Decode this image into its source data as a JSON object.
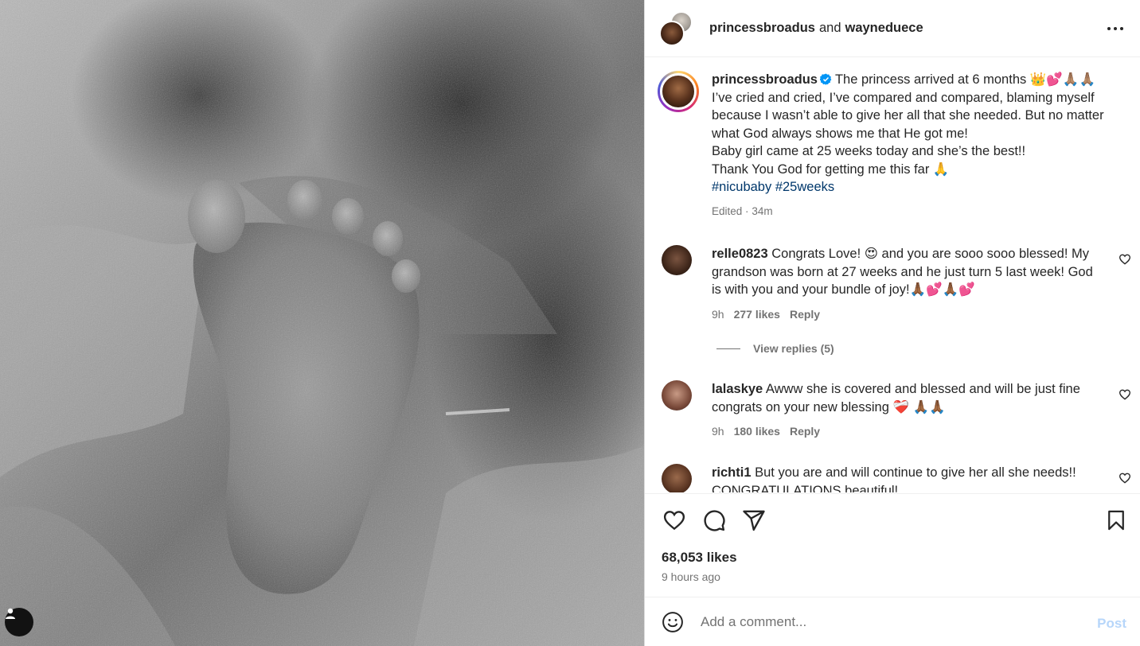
{
  "post": {
    "header": {
      "author": "princessbroadus",
      "joiner": "and",
      "collaborator": "wayneduece"
    },
    "caption": {
      "username": "princessbroadus",
      "lines": [
        "The princess arrived at 6 months 👑💕🙏🏽🙏🏽",
        "I’ve cried and cried, I’ve compared and compared, blaming myself because I wasn’t able to give her all that she needed. But no matter what God always shows me that He got me!",
        "Baby girl came at 25 weeks today and she’s the best!!",
        "Thank You God for getting me this far 🙏"
      ],
      "hashtags": [
        "#nicubaby",
        "#25weeks"
      ],
      "edited": "Edited",
      "dot": "·",
      "age": "34m"
    },
    "comments": [
      {
        "username": "relle0823",
        "text": "Congrats Love! 😍 and you are sooo sooo blessed! My grandson was born at 27 weeks and he just turn 5 last week! God is with you and your bundle of joy!🙏🏾💕🙏🏾💕",
        "time": "9h",
        "likes": "277 likes",
        "reply": "Reply"
      },
      {
        "username": "lalaskye",
        "text": "Awww she is covered and blessed and will be just fine congrats on your new blessing ❤️‍🩹 🙏🏾🙏🏾",
        "time": "9h",
        "likes": "180 likes",
        "reply": "Reply"
      },
      {
        "username": "richti1",
        "text": "But you are and will continue to give her all she needs!! CONGRATULATIONS beautiful!"
      }
    ],
    "view_replies": "View replies (5)",
    "likes": "68,053 likes",
    "posted": "9 hours ago",
    "add_comment_placeholder": "Add a comment...",
    "post_button": "Post"
  },
  "colors": {
    "link": "#00376b",
    "muted": "#737373",
    "verified": "#0095f6",
    "post_disabled": "#b7d6fa"
  }
}
